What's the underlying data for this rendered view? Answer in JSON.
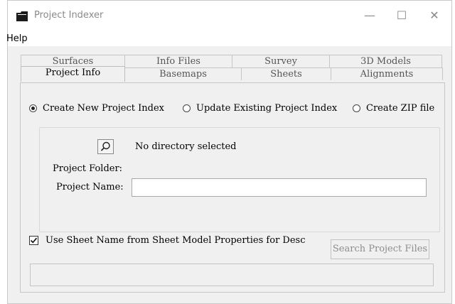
{
  "window": {
    "title": "Project Indexer",
    "minimize_glyph": "—",
    "maximize_glyph": "☐",
    "close_glyph": "✕"
  },
  "menu": {
    "help": "Help"
  },
  "tabs": {
    "back_row": [
      "Surfaces",
      "Info Files",
      "Survey",
      "3D Models"
    ],
    "front_row": [
      "Project Info",
      "Basemaps",
      "Sheets",
      "Alignments"
    ],
    "active": "Project Info"
  },
  "mode": {
    "options": [
      "Create New Project Index",
      "Update Existing Project Index",
      "Create ZIP file"
    ],
    "selected": "Create New Project Index"
  },
  "folder": {
    "status": "No directory selected",
    "folder_label": "Project Folder:",
    "name_label": "Project Name:",
    "name_value": ""
  },
  "options": {
    "use_sheet_name_label": "Use Sheet Name from Sheet Model Properties for Desc",
    "use_sheet_name_checked": true
  },
  "actions": {
    "search_label": "Search Project Files",
    "search_enabled": false
  },
  "icons": {
    "app": "folder-icon",
    "search": "magnifier-icon"
  },
  "colors": {
    "window_bg": "#f0f0f0",
    "disabled_text": "#8d8d8d"
  }
}
